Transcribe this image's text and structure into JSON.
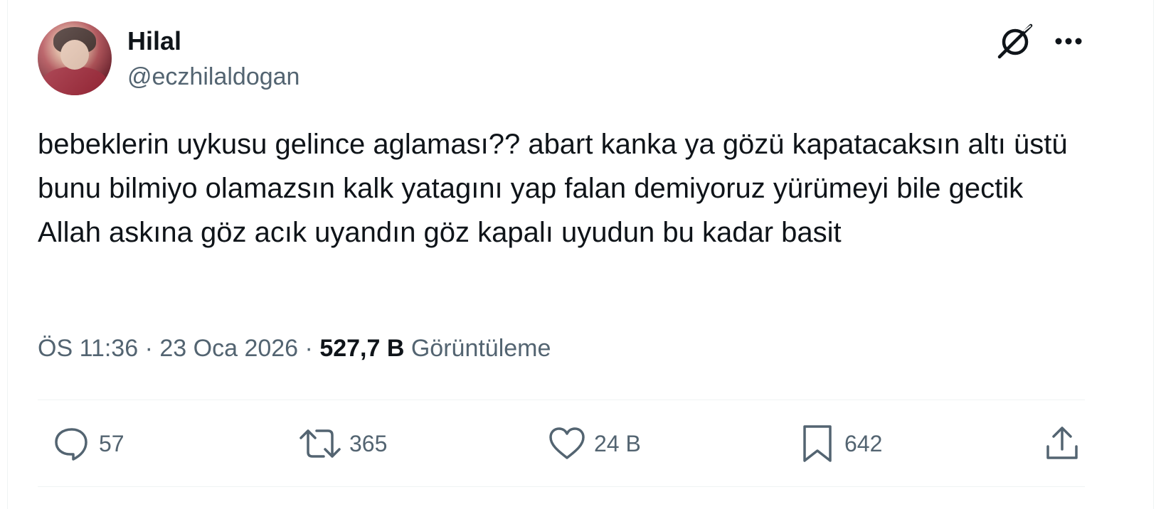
{
  "user": {
    "display_name": "Hilal",
    "handle": "@eczhilaldogan",
    "avatar_icon": "avatar-photo"
  },
  "header_icons": {
    "grok": "grok-icon",
    "more": "more-icon"
  },
  "tweet": {
    "text": "bebeklerin uykusu gelince aglaması?? abart kanka ya gözü kapatacaksın altı üstü bunu bilmiyo olamazsın kalk yatagını yap falan demiyoruz yürümeyi bile gectik Allah askına göz acık uyandın göz kapalı uyudun bu kadar basit"
  },
  "meta": {
    "time": "ÖS 11:36",
    "separator": "·",
    "date": "23 Oca 2026",
    "views_count": "527,7 B",
    "views_label": "Görüntüleme"
  },
  "actions": {
    "replies": "57",
    "reposts": "365",
    "likes": "24 B",
    "bookmarks": "642"
  },
  "colors": {
    "text_primary": "#0f1419",
    "text_secondary": "#536471",
    "divider": "#eff3f4"
  }
}
